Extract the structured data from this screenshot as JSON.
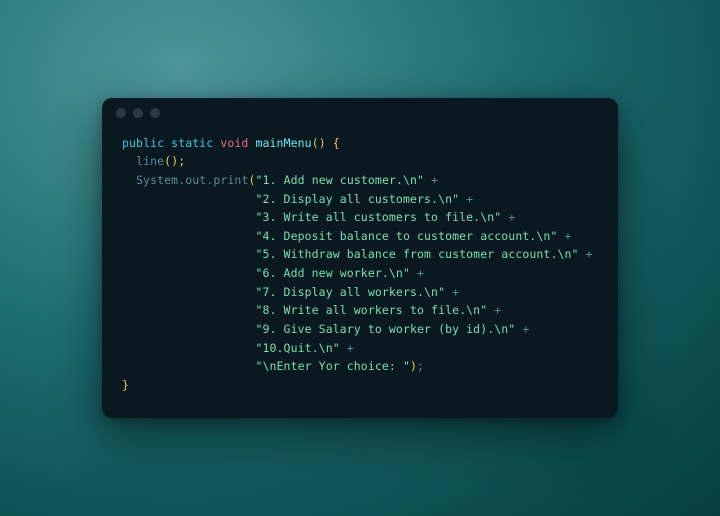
{
  "window": {
    "traffic_lights": [
      "dot1",
      "dot2",
      "dot3"
    ]
  },
  "code": {
    "sig_mod": "public static",
    "sig_void": "void",
    "sig_name": "mainMenu",
    "sig_parens": "()",
    "brace_open": "{",
    "brace_close": "}",
    "call_line": "line",
    "call_line_rest": "();",
    "sys": "System",
    "out": "out",
    "print": "print",
    "dot": ".",
    "paren_open": "(",
    "paren_close": ")",
    "semi": ";",
    "plus": "+",
    "strings": [
      "\"1. Add new customer.\\n\"",
      "\"2. Display all customers.\\n\"",
      "\"3. Write all customers to file.\\n\"",
      "\"4. Deposit balance to customer account.\\n\"",
      "\"5. Withdraw balance from customer account.\\n\"",
      "\"6. Add new worker.\\n\"",
      "\"7. Display all workers.\\n\"",
      "\"8. Write all workers to file.\\n\"",
      "\"9. Give Salary to worker (by id).\\n\"",
      "\"10.Quit.\\n\"",
      "\"\\nEnter Yor choice: \""
    ]
  }
}
